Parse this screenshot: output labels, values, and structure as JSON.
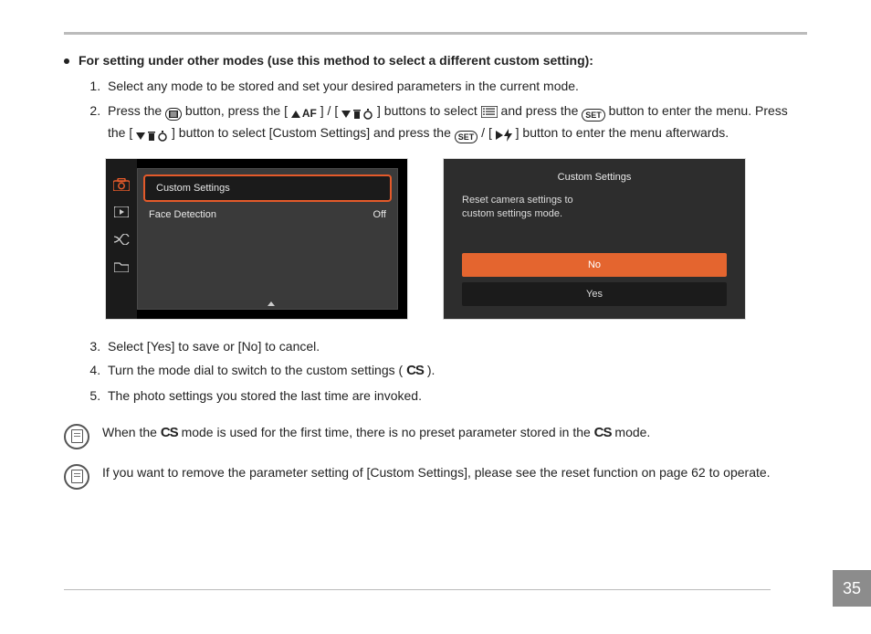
{
  "heading": "For setting under other modes (use this method to select a different custom setting):",
  "steps": {
    "s1": "Select any mode to be stored and set your desired parameters in the current mode.",
    "s2a": "Press the ",
    "s2b": " button, press the [ ",
    "s2c": " ] / [ ",
    "s2d": " ] buttons to select ",
    "s2e": " and press the ",
    "s2f": " button to enter the menu. Press the [ ",
    "s2g": " ] button to select [Custom Settings] and press the ",
    "s2h": " / [ ",
    "s2i": " ] button to enter the menu afterwards.",
    "s3": "Select [Yes] to save or [No] to cancel.",
    "s4a": "Turn the mode dial to switch to the custom settings ( ",
    "s4b": " ).",
    "s5": "The photo settings you stored the last time are invoked."
  },
  "labels": {
    "af": "AF",
    "set": "SET",
    "cs": "CS"
  },
  "screen1": {
    "menu_item_selected": "Custom Settings",
    "row2_label": "Face Detection",
    "row2_value": "Off"
  },
  "screen2": {
    "title": "Custom Settings",
    "msg_line1": "Reset camera settings to",
    "msg_line2": "custom settings mode.",
    "option_no": "No",
    "option_yes": "Yes"
  },
  "notes": {
    "n1a": "When the ",
    "n1b": " mode is used for the first time, there is no preset parameter stored in the ",
    "n1c": " mode.",
    "n2": "If you want to remove the parameter setting of [Custom Settings], please see the reset function on page 62 to operate."
  },
  "page_number": "35"
}
